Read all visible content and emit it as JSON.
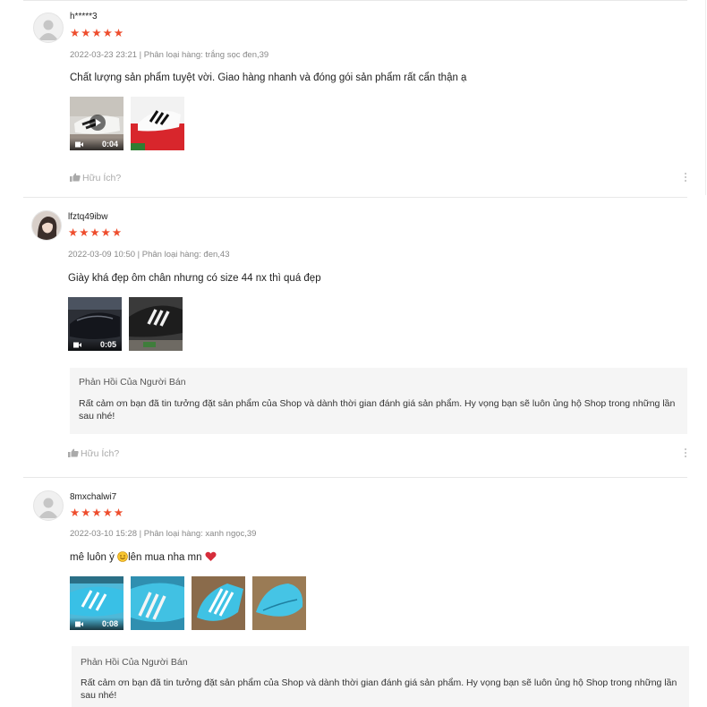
{
  "reviews": [
    {
      "username": "h*****3",
      "stars": "★★★★★",
      "meta": "2022-03-23 23:21 | Phân loại hàng: trắng sọc đen,39",
      "comment": "Chất lượng sản phẩm tuyệt vời. Giao hàng nhanh và đóng gói sản phẩm rất cẩn thận ạ",
      "video_duration": "0:04",
      "helpful_label": "Hữu Ích?"
    },
    {
      "username": "lfztq49ibw",
      "stars": "★★★★★",
      "meta": "2022-03-09 10:50 | Phân loại hàng: đen,43",
      "comment": "Giày khá đẹp ôm chân nhưng có size 44 nx thì quá đẹp",
      "video_duration": "0:05",
      "reply_title": "Phản Hồi Của Người Bán",
      "reply_text": "Rất cảm ơn bạn đã tin tưởng đặt sản phẩm của Shop và dành thời gian đánh giá sản phẩm. Hy vọng bạn sẽ luôn ủng hộ Shop trong những lần sau nhé!",
      "helpful_label": "Hữu Ích?"
    },
    {
      "username": "8mxchalwi7",
      "stars": "★★★★★",
      "meta": "2022-03-10 15:28 | Phân loại hàng: xanh ngọc,39",
      "comment_before": "mê luôn ý ",
      "comment_after": "lên mua nha mn ",
      "video_duration": "0:08",
      "reply_title": "Phản Hồi Của Người Bán",
      "reply_text": "Rất cảm ơn bạn đã tin tưởng đặt sản phẩm của Shop và dành thời gian đánh giá sản phẩm. Hy vọng bạn sẽ luôn ủng hộ Shop trong những lần sau nhé!"
    }
  ],
  "colors": {
    "star": "#ee4d2d",
    "meta": "#888888",
    "reply_bg": "#f5f5f5"
  },
  "icons": [
    "avatar-placeholder-icon",
    "star-icon",
    "video-camera-icon",
    "play-icon",
    "thumbs-up-icon",
    "more-vertical-icon",
    "smile-emoji-icon",
    "heart-emoji-icon"
  ]
}
